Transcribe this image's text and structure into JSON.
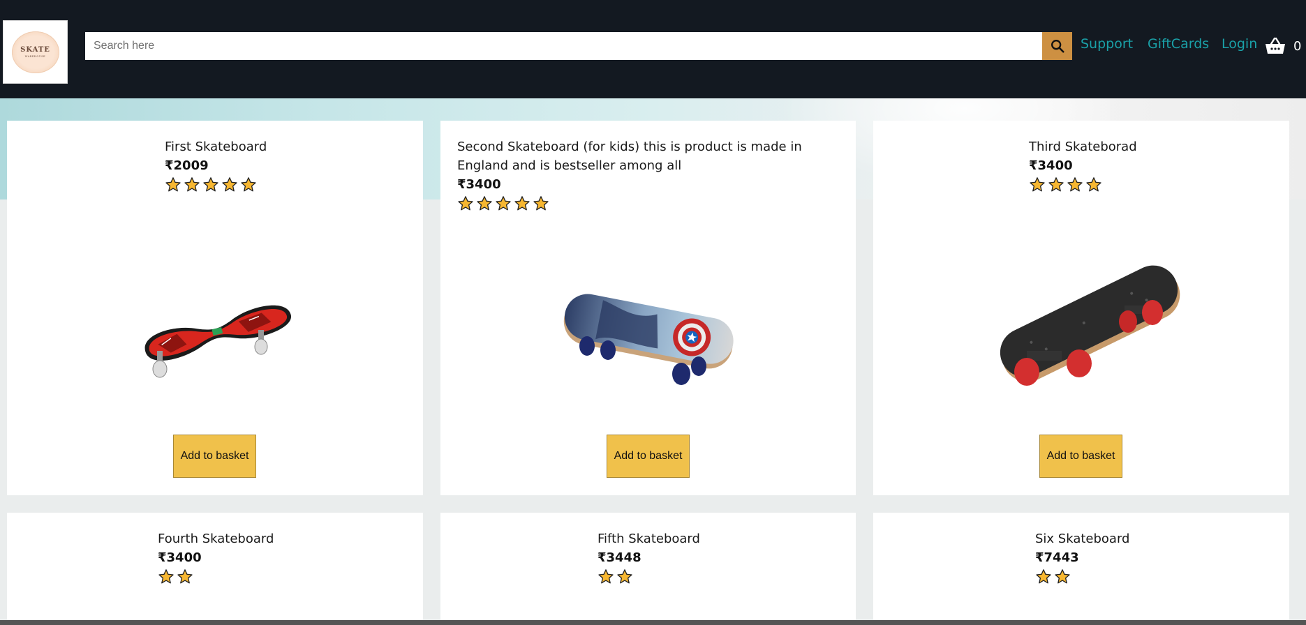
{
  "header": {
    "logo": {
      "line1": "SKATE",
      "line2": "WAREHOUSE"
    },
    "search": {
      "placeholder": "Search here",
      "value": "",
      "button_icon": "search-icon"
    },
    "nav": {
      "support": "Support",
      "giftcards": "GiftCards",
      "login": "Login"
    },
    "basket": {
      "icon": "basket-icon",
      "count": "0"
    }
  },
  "colors": {
    "header_bg": "#131921",
    "search_button": "#cd9042",
    "nav_link": "#1aa1a8",
    "add_button": "#f0c14b",
    "star": "#f7b731"
  },
  "products": [
    {
      "title": "First Skateboard",
      "price": "₹2009",
      "rating": 5,
      "image": "red-caster-board",
      "button": "Add to basket"
    },
    {
      "title": "Second Skateboard (for kids) this is product is made in England and is bestseller among all",
      "price": "₹3400",
      "rating": 5,
      "image": "captain-america-skateboard",
      "button": "Add to basket"
    },
    {
      "title": "Third Skateborad",
      "price": "₹3400",
      "rating": 4,
      "image": "black-skateboard",
      "button": "Add to basket"
    },
    {
      "title": "Fourth Skateboard",
      "price": "₹3400",
      "rating": 2
    },
    {
      "title": "Fifth Skateboard",
      "price": "₹3448",
      "rating": 2
    },
    {
      "title": "Six Skateboard",
      "price": "₹7443",
      "rating": 2
    }
  ]
}
